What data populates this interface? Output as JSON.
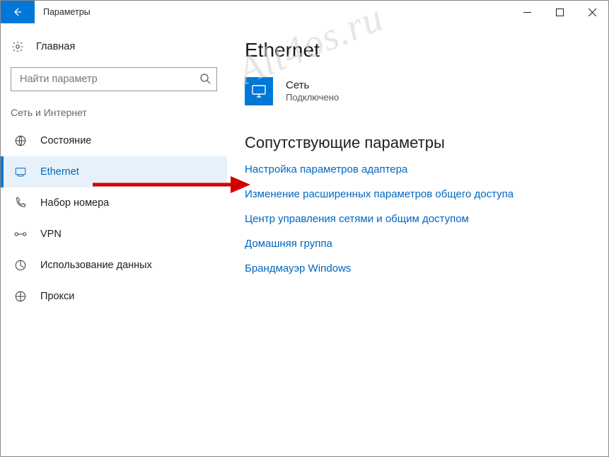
{
  "window": {
    "title": "Параметры"
  },
  "sidebar": {
    "home_label": "Главная",
    "search_placeholder": "Найти параметр",
    "group_title": "Сеть и Интернет",
    "items": [
      {
        "label": "Состояние"
      },
      {
        "label": "Ethernet"
      },
      {
        "label": "Набор номера"
      },
      {
        "label": "VPN"
      },
      {
        "label": "Использование данных"
      },
      {
        "label": "Прокси"
      }
    ]
  },
  "main": {
    "heading": "Ethernet",
    "network": {
      "name": "Сеть",
      "status": "Подключено"
    },
    "related_heading": "Сопутствующие параметры",
    "links": [
      "Настройка параметров адаптера",
      "Изменение расширенных параметров общего доступа",
      "Центр управления сетями и общим доступом",
      "Домашняя группа",
      "Брандмауэр Windows"
    ]
  },
  "watermark": "Alt4os.ru"
}
